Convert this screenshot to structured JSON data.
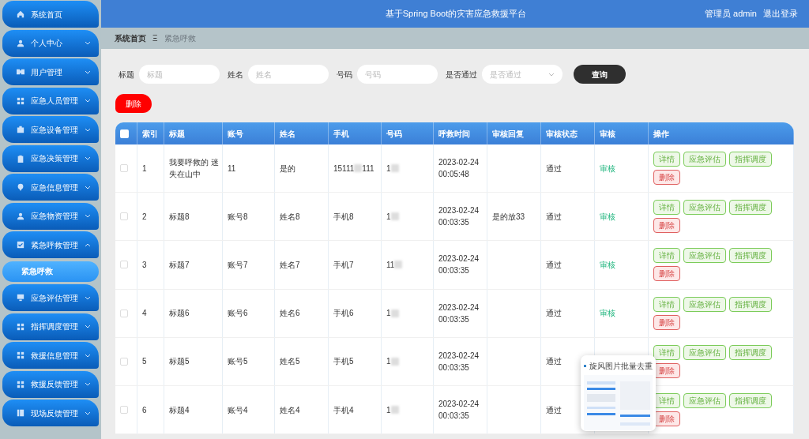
{
  "header": {
    "title": "基于Spring Boot的灾害应急救援平台",
    "user": "管理员 admin",
    "logout": "退出登录"
  },
  "breadcrumb": {
    "home": "系统首页",
    "separator": "Ξ",
    "current": "紧急呼救"
  },
  "sidebar": {
    "items": [
      {
        "label": "系统首页"
      },
      {
        "label": "个人中心",
        "expanded": false
      },
      {
        "label": "用户管理",
        "expanded": false
      },
      {
        "label": "应急人员管理",
        "expanded": false
      },
      {
        "label": "应急设备管理",
        "expanded": false
      },
      {
        "label": "应急决策管理",
        "expanded": false
      },
      {
        "label": "应急信息管理",
        "expanded": false
      },
      {
        "label": "应急物资管理",
        "expanded": false
      },
      {
        "label": "紧急呼救管理",
        "expanded": true,
        "children": [
          {
            "label": "紧急呼救",
            "selected": true
          }
        ]
      },
      {
        "label": "应急评估管理",
        "expanded": false
      },
      {
        "label": "指挥调度管理",
        "expanded": false
      },
      {
        "label": "救援信息管理",
        "expanded": false
      },
      {
        "label": "救援反馈管理",
        "expanded": false
      },
      {
        "label": "现场反馈管理",
        "expanded": false
      }
    ]
  },
  "search": {
    "fields": [
      {
        "label": "标题",
        "placeholder": "标题",
        "kind": "text"
      },
      {
        "label": "姓名",
        "placeholder": "姓名",
        "kind": "text"
      },
      {
        "label": "号码",
        "placeholder": "号码",
        "kind": "text"
      },
      {
        "label": "是否通过",
        "placeholder": "是否通过",
        "kind": "select"
      }
    ],
    "button": "查询"
  },
  "delete_button": "删除",
  "table": {
    "select_all_checked": false,
    "columns": [
      "索引",
      "标题",
      "账号",
      "姓名",
      "手机",
      "号码",
      "呼救时间",
      "审核回复",
      "审核状态",
      "审核",
      "操作"
    ],
    "rows": [
      {
        "checked": false,
        "index": "1",
        "title": "我要呼救的 迷失在山中",
        "account": "11",
        "name": "是的",
        "phone": [
          "15111",
          "111"
        ],
        "number": "1",
        "time": "2023-02-24 00:05:48",
        "status": "通过",
        "audit": "审核",
        "actions": [
          {
            "label": "详情",
            "kind": "ok"
          },
          {
            "label": "应急评估",
            "kind": "ok"
          },
          {
            "label": "指挥调度",
            "kind": "ok"
          },
          {
            "label": "删除",
            "kind": "danger"
          }
        ]
      },
      {
        "checked": false,
        "index": "2",
        "title": "标题8",
        "account": "账号8",
        "name": "姓名8",
        "phone": [
          "手机8"
        ],
        "number": "1",
        "time": "2023-02-24 00:03:35",
        "reply": "是的放33",
        "status": "通过",
        "audit": "审核",
        "actions": [
          {
            "label": "详情",
            "kind": "ok"
          },
          {
            "label": "应急评估",
            "kind": "ok"
          },
          {
            "label": "指挥调度",
            "kind": "ok"
          },
          {
            "label": "删除",
            "kind": "danger"
          }
        ]
      },
      {
        "checked": false,
        "index": "3",
        "title": "标题7",
        "account": "账号7",
        "name": "姓名7",
        "phone": [
          "手机7"
        ],
        "number": "11",
        "time": "2023-02-24 00:03:35",
        "status": "通过",
        "audit": "审核",
        "actions": [
          {
            "label": "详情",
            "kind": "ok"
          },
          {
            "label": "应急评估",
            "kind": "ok"
          },
          {
            "label": "指挥调度",
            "kind": "ok"
          },
          {
            "label": "删除",
            "kind": "danger"
          }
        ]
      },
      {
        "checked": false,
        "index": "4",
        "title": "标题6",
        "account": "账号6",
        "name": "姓名6",
        "phone": [
          "手机6"
        ],
        "number": "1",
        "time": "2023-02-24 00:03:35",
        "status": "通过",
        "audit": "审核",
        "actions": [
          {
            "label": "详情",
            "kind": "ok"
          },
          {
            "label": "应急评估",
            "kind": "ok"
          },
          {
            "label": "指挥调度",
            "kind": "ok"
          },
          {
            "label": "删除",
            "kind": "danger"
          }
        ]
      },
      {
        "checked": false,
        "index": "5",
        "title": "标题5",
        "account": "账号5",
        "name": "姓名5",
        "phone": [
          "手机5"
        ],
        "number": "1",
        "time": "2023-02-24 00:03:35",
        "status": "通过",
        "actions": [
          {
            "label": "详情",
            "kind": "ok"
          },
          {
            "label": "应急评估",
            "kind": "ok"
          },
          {
            "label": "指挥调度",
            "kind": "ok"
          },
          {
            "label": "删除",
            "kind": "danger"
          }
        ]
      },
      {
        "checked": false,
        "index": "6",
        "title": "标题4",
        "account": "账号4",
        "name": "姓名4",
        "phone": [
          "手机4"
        ],
        "number": "1",
        "time": "2023-02-24 00:03:35",
        "status": "通过",
        "actions": [
          {
            "label": "详情",
            "kind": "ok"
          },
          {
            "label": "应急评估",
            "kind": "ok"
          },
          {
            "label": "指挥调度",
            "kind": "ok"
          },
          {
            "label": "删除",
            "kind": "danger"
          }
        ]
      }
    ]
  },
  "popup": {
    "title": "旋风图片批量去重"
  }
}
